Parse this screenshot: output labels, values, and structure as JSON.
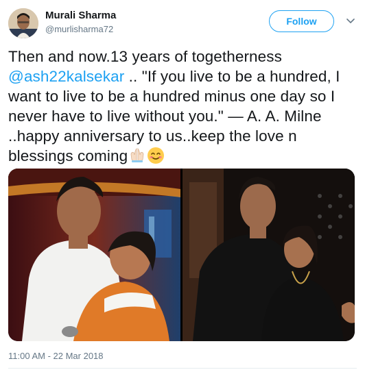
{
  "author": {
    "name": "Murali Sharma",
    "handle": "@murlisharma72"
  },
  "actions": {
    "follow_label": "Follow"
  },
  "tweet": {
    "text_before_mention": "Then and now.13 years of togetherness",
    "mention": "@ash22kalsekar",
    "text_after_mention": " .. \"If you live to be a hundred, I want to live to be a hundred minus one day so I never have to live without you.\" — A. A. Milne ..happy anniversary to us..keep the love n blessings coming",
    "emojis": [
      "folded-hands-light-skin-tone",
      "smiling-face-with-smiling-eyes"
    ]
  },
  "media": {
    "count": 2
  },
  "timestamp": "11:00 AM - 22 Mar 2018",
  "colors": {
    "link": "#1da1f2",
    "primary_text": "#14171a",
    "secondary_text": "#657786",
    "divider": "#e6ecf0"
  }
}
